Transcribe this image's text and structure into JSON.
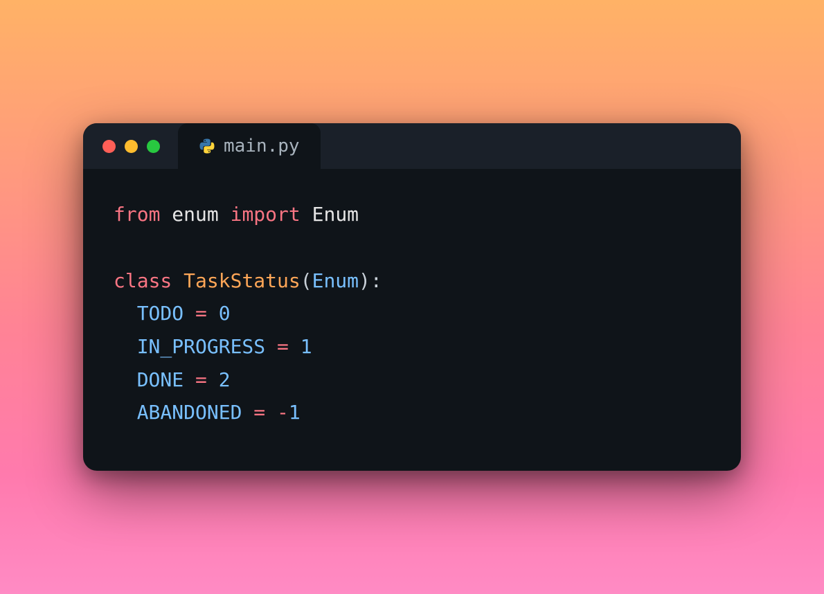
{
  "tab": {
    "filename": "main.py"
  },
  "code": {
    "line1": {
      "from": "from",
      "module": "enum",
      "import": "import",
      "name": "Enum"
    },
    "line3": {
      "class": "class",
      "classname": "TaskStatus",
      "lparen": "(",
      "base": "Enum",
      "rparen": ")",
      "colon": ":"
    },
    "line4": {
      "attr": "TODO",
      "op": " = ",
      "value": "0"
    },
    "line5": {
      "attr": "IN_PROGRESS",
      "op": " = ",
      "value": "1"
    },
    "line6": {
      "attr": "DONE",
      "op": " = ",
      "value": "2"
    },
    "line7": {
      "attr": "ABANDONED",
      "op": " = ",
      "minus": "-",
      "value": "1"
    }
  }
}
